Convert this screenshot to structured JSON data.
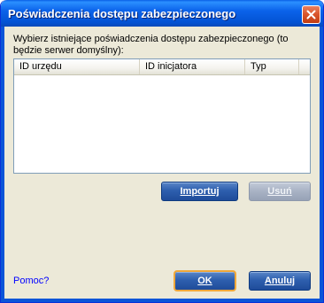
{
  "window": {
    "title": "Poświadczenia dostępu zabezpieczonego",
    "close_icon": "close-icon"
  },
  "instruction": "Wybierz istniejące poświadczenia dostępu zabezpieczonego (to będzie serwer domyślny):",
  "credentials_list": {
    "columns": [
      "ID urzędu",
      "ID inicjatora",
      "Typ",
      ""
    ],
    "rows": []
  },
  "buttons": {
    "import": "Importuj",
    "remove": "Usuń",
    "ok": "OK",
    "cancel": "Anuluj"
  },
  "help_link": "Pomoc?",
  "colors": {
    "titlebar": "#0b63ea",
    "frame": "#0b55d8",
    "dialog_bg": "#ece9d8",
    "button": "#2e5fae",
    "button_disabled": "#a8b2c4",
    "link": "#0000ff"
  }
}
